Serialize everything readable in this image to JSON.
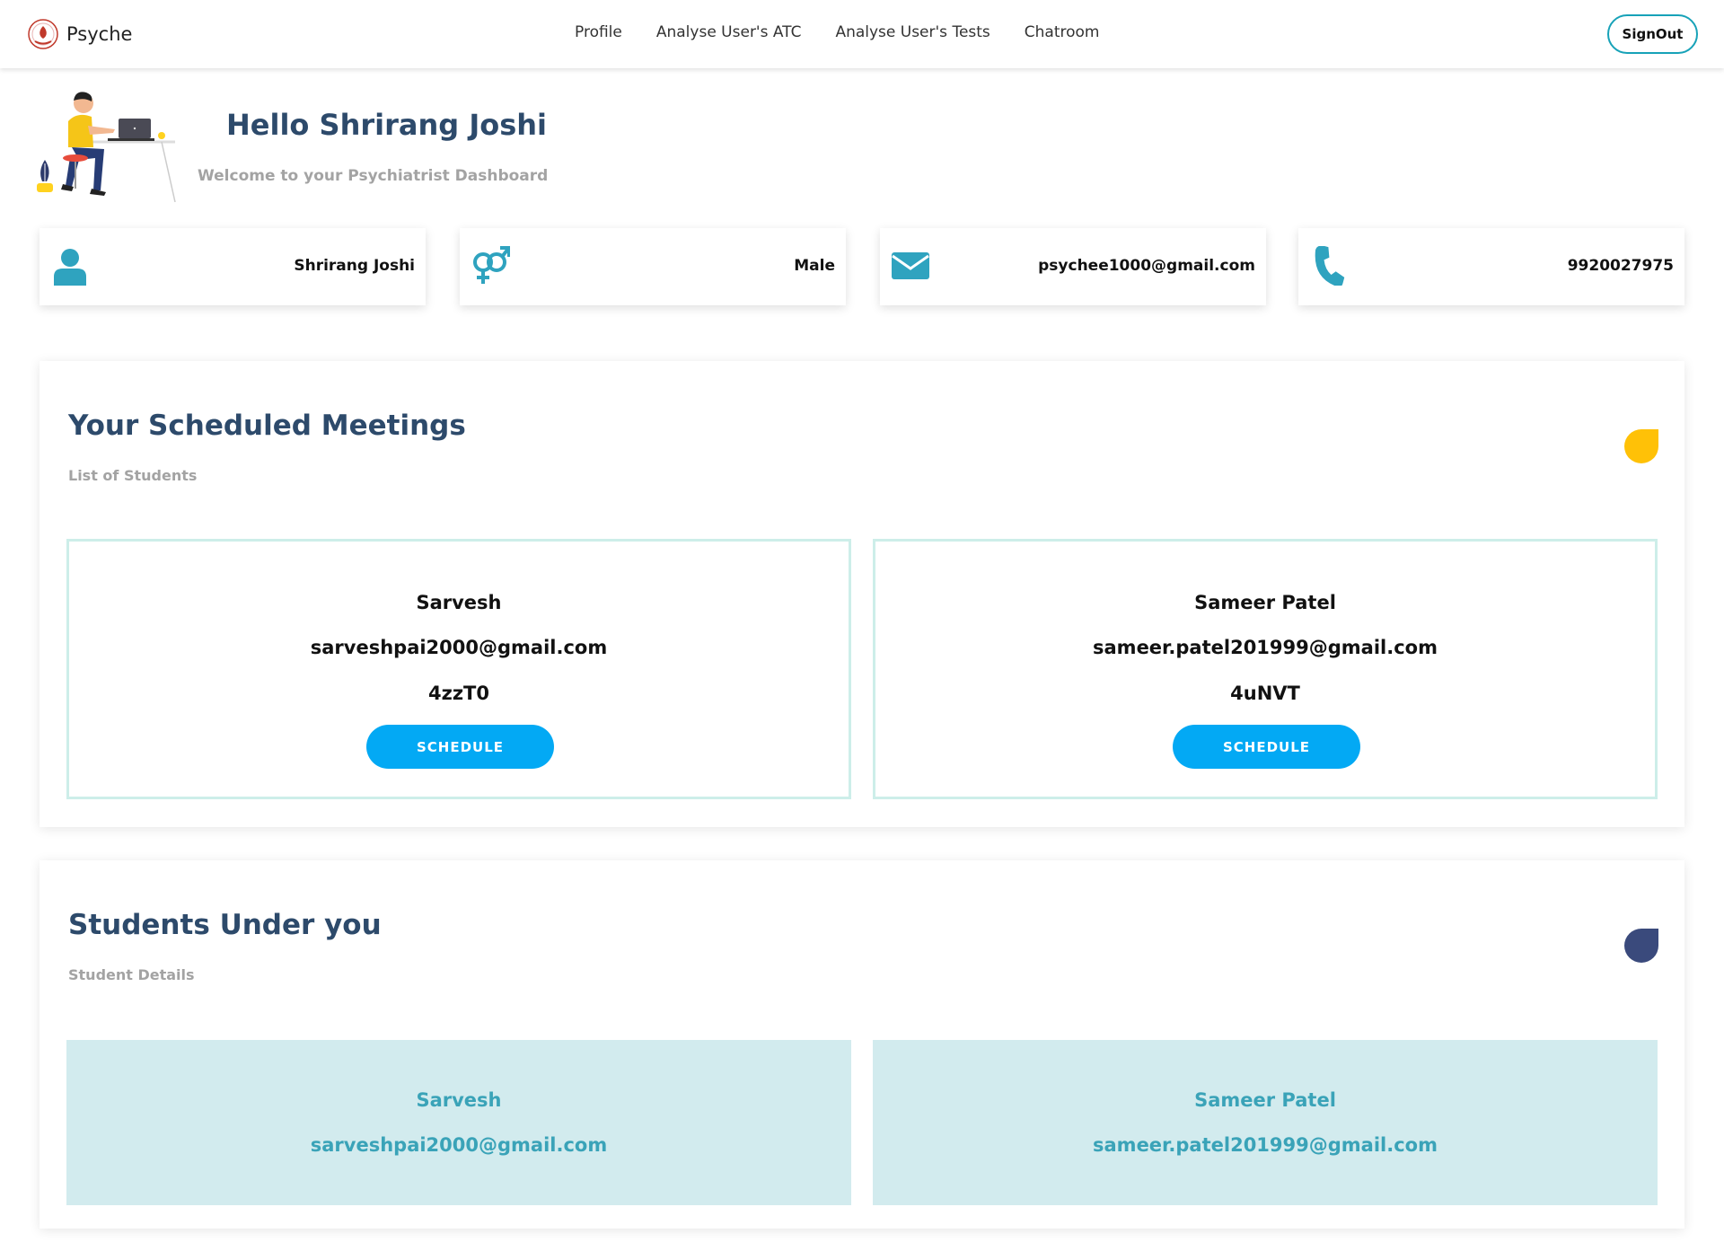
{
  "nav": {
    "brand": "Psyche",
    "links": [
      "Profile",
      "Analyse User's ATC",
      "Analyse User's Tests",
      "Chatroom"
    ],
    "signout": "SignOut"
  },
  "hero": {
    "title": "Hello Shrirang Joshi",
    "subtitle": "Welcome to your Psychiatrist Dashboard"
  },
  "info": [
    {
      "icon": "user-icon",
      "value": "Shrirang Joshi"
    },
    {
      "icon": "gender-icon",
      "value": "Male"
    },
    {
      "icon": "envelope-icon",
      "value": "psychee1000@gmail.com"
    },
    {
      "icon": "phone-icon",
      "value": "9920027975"
    }
  ],
  "meetings": {
    "title": "Your Scheduled Meetings",
    "subtitle": "List of Students",
    "accent": "#ffc107",
    "items": [
      {
        "name": "Sarvesh",
        "email": "sarveshpai2000@gmail.com",
        "code": "4zzT0",
        "button": "SCHEDULE"
      },
      {
        "name": "Sameer Patel",
        "email": "sameer.patel201999@gmail.com",
        "code": "4uNVT",
        "button": "SCHEDULE"
      }
    ]
  },
  "students": {
    "title": "Students Under you",
    "subtitle": "Student Details",
    "accent": "#3a4a7c",
    "items": [
      {
        "name": "Sarvesh",
        "email": "sarveshpai2000@gmail.com"
      },
      {
        "name": "Sameer Patel",
        "email": "sameer.patel201999@gmail.com"
      }
    ]
  },
  "colors": {
    "icon": "#2fa3bf",
    "heading": "#2d4a6b",
    "button": "#03a9f4",
    "student_card_bg": "#d2ebee",
    "student_text": "#3aa3b8"
  }
}
